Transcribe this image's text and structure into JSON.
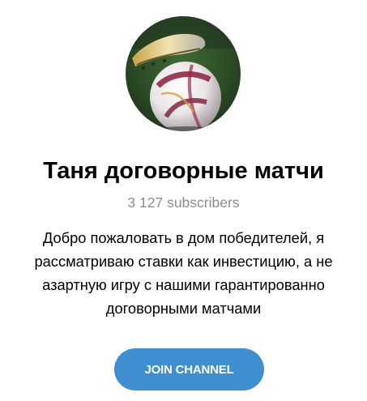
{
  "channel": {
    "title": "Таня договорные матчи",
    "subscribers": "3 127 subscribers",
    "description_lines": [
      "Добро пожаловать в дом победителей, я",
      "рассматриваю ставки как инвестицию, а не",
      "азартную игру с нашими гарантированно",
      "договорными матчами"
    ],
    "avatar_icon": "football-photo-icon"
  },
  "actions": {
    "join_label": "JOIN CHANNEL"
  },
  "colors": {
    "accent": "#3f8ed0",
    "subtitle": "#8c8c8c",
    "text": "#000000"
  }
}
